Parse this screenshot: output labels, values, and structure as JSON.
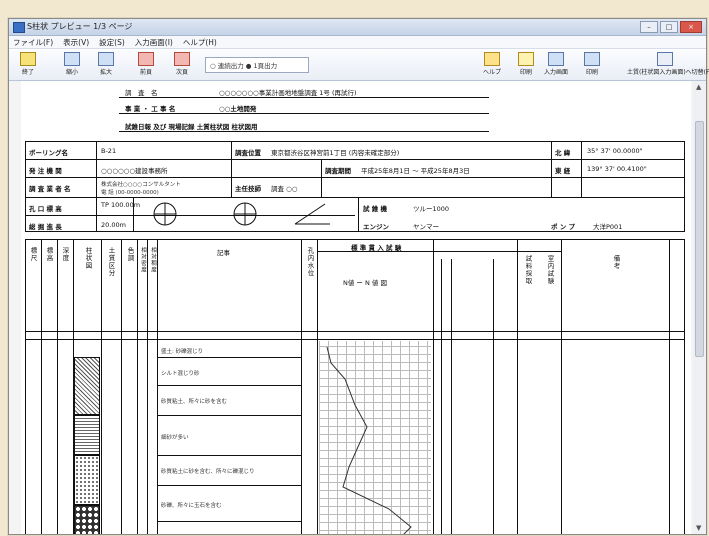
{
  "window": {
    "title": "S柱状 プレビュー  1/3 ページ",
    "controls": [
      "–",
      "□",
      "×"
    ]
  },
  "menu": [
    "ファイル(F)",
    "表示(V)",
    "設定(S)",
    "入力画面(I)",
    "ヘルプ(H)"
  ],
  "toolbar": {
    "buttons": [
      {
        "label": "終了",
        "icon": "exit-icon"
      },
      {
        "label": "縮小",
        "icon": "zoom-out-icon"
      },
      {
        "label": "拡大",
        "icon": "zoom-in-icon"
      },
      {
        "label": "前頁",
        "icon": "prev-page-icon"
      },
      {
        "label": "次頁",
        "icon": "next-page-icon"
      }
    ],
    "output_mode": "○ 連続出力  ● 1頁出力",
    "right_buttons": [
      {
        "label": "ヘルプ",
        "icon": "help-icon"
      },
      {
        "label": "印刷",
        "icon": "print-icon"
      },
      {
        "label": "入力画面",
        "icon": "input-screen-icon"
      },
      {
        "label": "印刷",
        "icon": "print-icon"
      },
      {
        "label": "土質(柱状図入力画面)へ切替(F3)",
        "icon": "switch-icon"
      }
    ]
  },
  "sheet": {
    "header": {
      "project_label": "調　査　名",
      "project_name": "○○○○○○○事業計画地地盤調査 1号 (再試行)",
      "work_label": "事 業 ・ 工 事 名",
      "work_name": "○○土地開発",
      "sheet_title": "試錐日報 及び 現場記録 土質柱状図 柱状図用"
    },
    "info": {
      "boring_name_label": "ボーリング名",
      "boring_name": "B-21",
      "site_label": "調査位置",
      "site": "東京都渋谷区神宮前1丁目 (内容未確定部分)",
      "lat_label": "北 緯",
      "lat": "35° 37' 00.0000\"",
      "client_label": "発 注 機 関",
      "client": "○○○○○○建設事務所",
      "period_label": "調査期間",
      "period": "平成25年8月1日 〜 平成25年8月3日",
      "lon_label": "東 経",
      "lon": "139° 37' 00.4100\"",
      "company_label": "調 査 業 者 名",
      "company": "株式会社○○○○コンサルタント",
      "tel": "電 話 (00-0000-0000)",
      "chief_label": "主任技師",
      "chief": "調査 ○○",
      "elev_label": "孔 口 標 高",
      "elev": "TP 100.00m",
      "depth_label": "総 掘 進 長",
      "depth": "20.00m",
      "rig_label": "試 錐 機",
      "rig": "ツルー1000",
      "engine_label": "エンジン",
      "engine": "ヤンマー",
      "pump_label": "ポ ン プ",
      "pump": "大洋P001"
    },
    "columns": [
      "標尺",
      "標高",
      "深度",
      "柱状図",
      "土質区分",
      "色調",
      "相対密度",
      "相対稠度",
      "記事",
      "孔内水位",
      "標準貫入試験",
      "試料採取",
      "室内試験",
      "備考"
    ],
    "std_pen_title": "標 準 貫 入 試 験",
    "nvalue_title": "N値 ー N 値 図",
    "rows": [
      {
        "note": "盛土: 砂礫混じり"
      },
      {
        "note": "シルト混じり砂"
      },
      {
        "note": "砂質粘土、所々に砂を含む"
      },
      {
        "note": "細砂が多い"
      },
      {
        "note": "砂質粘土に砂を含む、所々に礫混じり"
      },
      {
        "note": "砂礫、所々に玉石を含む"
      }
    ]
  }
}
